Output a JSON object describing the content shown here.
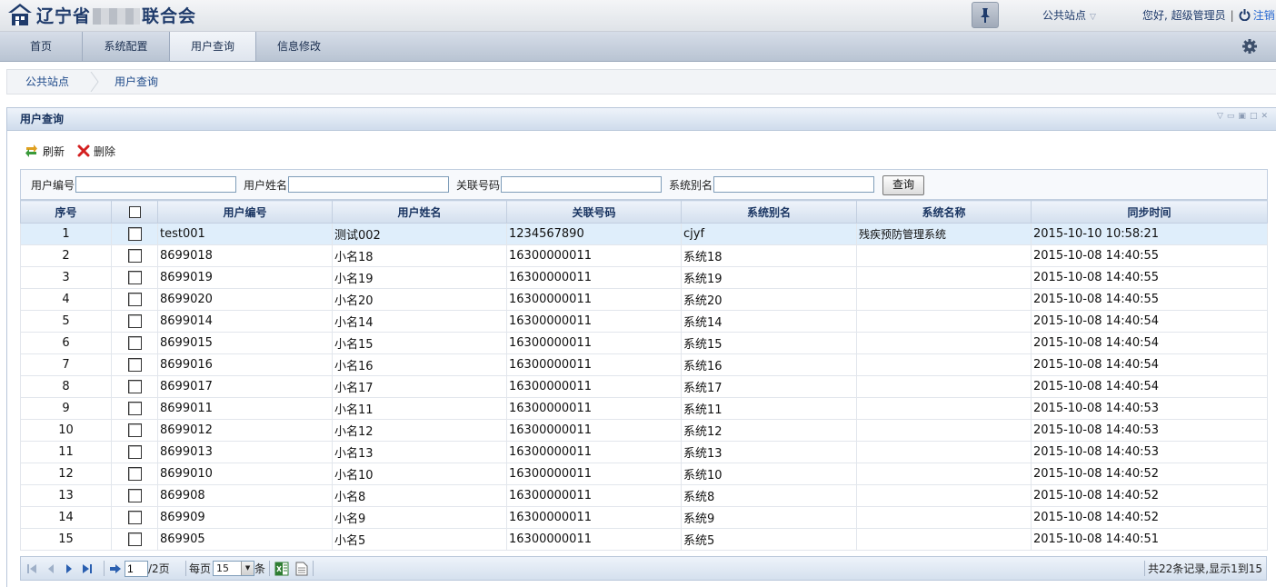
{
  "header": {
    "title_prefix": "辽宁省",
    "title_suffix": "联合会",
    "site_menu": "公共站点",
    "greeting": "您好, 超级管理员",
    "logout": "注销"
  },
  "nav": {
    "tabs": [
      {
        "label": "首页",
        "active": false
      },
      {
        "label": "系统配置",
        "active": false
      },
      {
        "label": "用户查询",
        "active": true
      },
      {
        "label": "信息修改",
        "active": false
      }
    ]
  },
  "breadcrumb": [
    "公共站点",
    "用户查询"
  ],
  "panel": {
    "title": "用户查询",
    "toolbar": {
      "refresh": "刷新",
      "delete": "删除"
    }
  },
  "search": {
    "user_id_label": "用户编号",
    "user_name_label": "用户姓名",
    "link_no_label": "关联号码",
    "alias_label": "系统别名",
    "user_id_value": "",
    "user_name_value": "",
    "link_no_value": "",
    "alias_value": "",
    "query_button": "查询"
  },
  "table": {
    "columns": [
      "序号",
      "",
      "用户编号",
      "用户姓名",
      "关联号码",
      "系统别名",
      "系统名称",
      "同步时间"
    ],
    "rows": [
      {
        "idx": "1",
        "uid": "test001",
        "name": "测试002",
        "phone": "1234567890",
        "alias": "cjyf",
        "sysname": "残疾预防管理系统",
        "time": "2015-10-10 10:58:21",
        "selected": true
      },
      {
        "idx": "2",
        "uid": "8699018",
        "name": "小名18",
        "phone": "16300000011",
        "alias": "系统18",
        "sysname": "",
        "time": "2015-10-08 14:40:55"
      },
      {
        "idx": "3",
        "uid": "8699019",
        "name": "小名19",
        "phone": "16300000011",
        "alias": "系统19",
        "sysname": "",
        "time": "2015-10-08 14:40:55"
      },
      {
        "idx": "4",
        "uid": "8699020",
        "name": "小名20",
        "phone": "16300000011",
        "alias": "系统20",
        "sysname": "",
        "time": "2015-10-08 14:40:55"
      },
      {
        "idx": "5",
        "uid": "8699014",
        "name": "小名14",
        "phone": "16300000011",
        "alias": "系统14",
        "sysname": "",
        "time": "2015-10-08 14:40:54"
      },
      {
        "idx": "6",
        "uid": "8699015",
        "name": "小名15",
        "phone": "16300000011",
        "alias": "系统15",
        "sysname": "",
        "time": "2015-10-08 14:40:54"
      },
      {
        "idx": "7",
        "uid": "8699016",
        "name": "小名16",
        "phone": "16300000011",
        "alias": "系统16",
        "sysname": "",
        "time": "2015-10-08 14:40:54"
      },
      {
        "idx": "8",
        "uid": "8699017",
        "name": "小名17",
        "phone": "16300000011",
        "alias": "系统17",
        "sysname": "",
        "time": "2015-10-08 14:40:54"
      },
      {
        "idx": "9",
        "uid": "8699011",
        "name": "小名11",
        "phone": "16300000011",
        "alias": "系统11",
        "sysname": "",
        "time": "2015-10-08 14:40:53"
      },
      {
        "idx": "10",
        "uid": "8699012",
        "name": "小名12",
        "phone": "16300000011",
        "alias": "系统12",
        "sysname": "",
        "time": "2015-10-08 14:40:53"
      },
      {
        "idx": "11",
        "uid": "8699013",
        "name": "小名13",
        "phone": "16300000011",
        "alias": "系统13",
        "sysname": "",
        "time": "2015-10-08 14:40:53"
      },
      {
        "idx": "12",
        "uid": "8699010",
        "name": "小名10",
        "phone": "16300000011",
        "alias": "系统10",
        "sysname": "",
        "time": "2015-10-08 14:40:52"
      },
      {
        "idx": "13",
        "uid": "869908",
        "name": "小名8",
        "phone": "16300000011",
        "alias": "系统8",
        "sysname": "",
        "time": "2015-10-08 14:40:52"
      },
      {
        "idx": "14",
        "uid": "869909",
        "name": "小名9",
        "phone": "16300000011",
        "alias": "系统9",
        "sysname": "",
        "time": "2015-10-08 14:40:52"
      },
      {
        "idx": "15",
        "uid": "869905",
        "name": "小名5",
        "phone": "16300000011",
        "alias": "系统5",
        "sysname": "",
        "time": "2015-10-08 14:40:51"
      }
    ]
  },
  "pager": {
    "page_value": "1",
    "total_pages": "/2页",
    "per_page_label": "每页",
    "per_page_value": "15",
    "unit": "条",
    "summary": "共22条记录,显示1到15"
  },
  "colors": {
    "accent": "#1f3b6b",
    "link": "#2a6ad1",
    "delete_icon": "#d32020"
  },
  "icons": [
    "home-logo-icon",
    "pin-icon",
    "chevron-down-icon",
    "power-icon",
    "gear-icon",
    "refresh-icon",
    "delete-icon",
    "first-page-icon",
    "prev-page-icon",
    "next-page-icon",
    "last-page-icon",
    "go-icon",
    "excel-export-icon",
    "document-export-icon"
  ]
}
